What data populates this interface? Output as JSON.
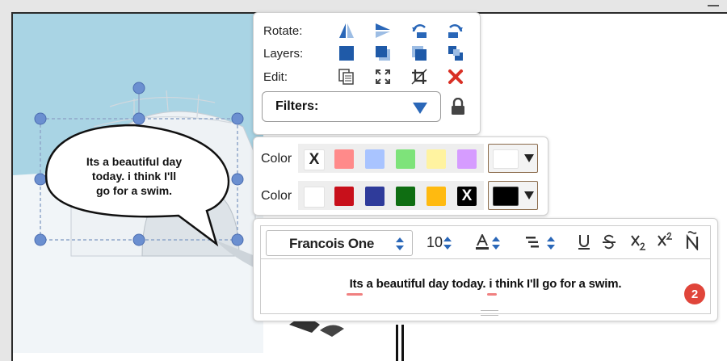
{
  "actions_menu": {
    "rotate_label": "Rotate:",
    "layers_label": "Layers:",
    "edit_label": "Edit:",
    "filters_label": "Filters:"
  },
  "colors_menu": {
    "rows": [
      {
        "label": "Color",
        "swatches": [
          {
            "color": "#ffffff",
            "x": "X"
          },
          {
            "color": "#ff8a8a"
          },
          {
            "color": "#a9c4ff"
          },
          {
            "color": "#7ee37a"
          },
          {
            "color": "#fff3a0"
          },
          {
            "color": "#d69cff"
          }
        ],
        "current": "#ffffff"
      },
      {
        "label": "Color",
        "swatches": [
          {
            "color": "#ffffff"
          },
          {
            "color": "#c8101b"
          },
          {
            "color": "#2f3b9a"
          },
          {
            "color": "#0f6e12"
          },
          {
            "color": "#ffba10"
          },
          {
            "color": "#000000",
            "x": "X"
          }
        ],
        "current": "#000000"
      }
    ]
  },
  "text_editor": {
    "font": "Francois One",
    "size": "10",
    "content": "Its a beautiful day today. i think I'll go for a swim.",
    "badge_count": "2"
  },
  "speech_bubble": {
    "text": "Its a beautiful day today. i think I'll go for a swim."
  },
  "accent": "#2a67b8"
}
